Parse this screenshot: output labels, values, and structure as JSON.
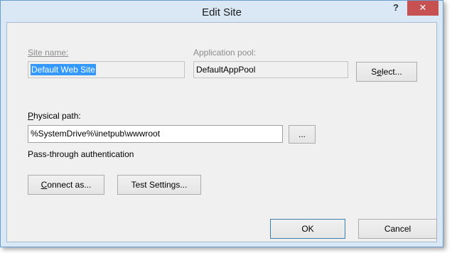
{
  "window": {
    "title": "Edit Site",
    "help_label": "?",
    "close_label": "✕"
  },
  "form": {
    "site_name_label": "Site name:",
    "site_name_value": "Default Web Site",
    "app_pool_label": "Application pool:",
    "app_pool_value": "DefaultAppPool",
    "select_button_pre": "S",
    "select_button_mn": "e",
    "select_button_post": "lect...",
    "physical_path_label_mn": "P",
    "physical_path_label_rest": "hysical path:",
    "physical_path_value": "%SystemDrive%\\inetpub\\wwwroot",
    "browse_button": "...",
    "auth_label": "Pass-through authentication",
    "connect_as_mn": "C",
    "connect_as_rest": "onnect as...",
    "test_settings_pre": "Test Settin",
    "test_settings_mn": "g",
    "test_settings_post": "s..."
  },
  "footer": {
    "ok_label": "OK",
    "cancel_label": "Cancel"
  },
  "colors": {
    "frame": "#dae8f6",
    "close_button": "#c75050",
    "selection": "#3399ff",
    "client_bg": "#f0f0f0"
  }
}
